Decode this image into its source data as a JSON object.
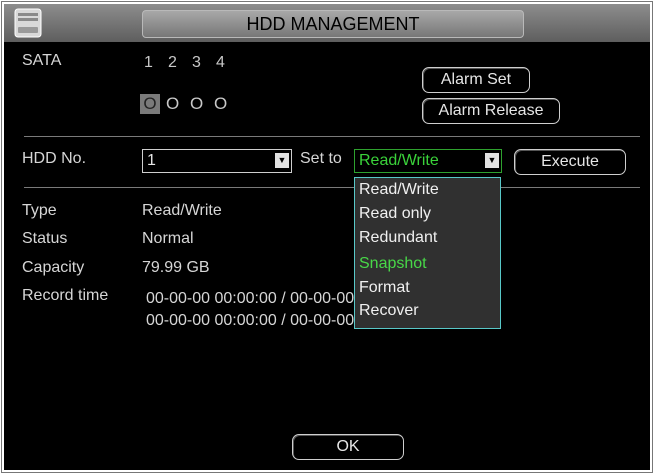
{
  "title": "HDD MANAGEMENT",
  "sata": {
    "label": "SATA",
    "numbers": [
      "1",
      "2",
      "3",
      "4"
    ],
    "status": [
      "O",
      "O",
      "O",
      "O"
    ]
  },
  "alarm_set_label": "Alarm Set",
  "alarm_release_label": "Alarm Release",
  "hdd_no": {
    "label": "HDD No.",
    "value": "1"
  },
  "set_to": {
    "label": "Set to",
    "value": "Read/Write"
  },
  "execute_label": "Execute",
  "dropdown_options": [
    "Read/Write",
    "Read only",
    "Redundant",
    "Snapshot",
    "Format",
    "Recover"
  ],
  "dropdown_highlighted": "Snapshot",
  "info": {
    "type_label": "Type",
    "type_value": "Read/Write",
    "status_label": "Status",
    "status_value": "Normal",
    "capacity_label": "Capacity",
    "capacity_value": "79.99 GB",
    "record_label": "Record time",
    "record_line1": "00-00-00 00:00:00 / 00-00-00 00:00:00",
    "record_line2": "00-00-00 00:00:00 / 00-00-00 00:00:00"
  },
  "ok_label": "OK",
  "colors": {
    "highlight": "#48d848",
    "dropdown_border": "#58c8c8",
    "titlebar": "#8d8d8d"
  }
}
